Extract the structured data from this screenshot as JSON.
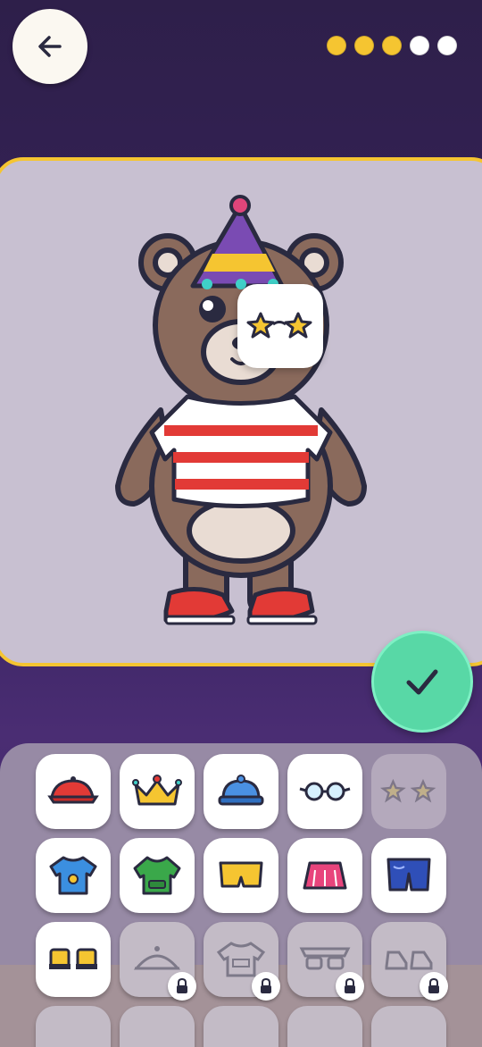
{
  "progress": {
    "completed": 3,
    "total": 5,
    "filled_color": "#f5c531",
    "empty_color": "#ffffff"
  },
  "colors": {
    "stage_border": "#f5c531",
    "confirm": "#58d8a6",
    "bear": "#8a6a5c",
    "outline": "#2a2a40"
  },
  "wardrobe": {
    "items": [
      {
        "icon": "beret-icon",
        "state": "available"
      },
      {
        "icon": "crown-icon",
        "state": "available"
      },
      {
        "icon": "beanie-icon",
        "state": "available"
      },
      {
        "icon": "round-glasses-icon",
        "state": "available"
      },
      {
        "icon": "star-glasses-icon",
        "state": "selected"
      },
      {
        "icon": "blue-tshirt-icon",
        "state": "available"
      },
      {
        "icon": "green-hoodie-icon",
        "state": "available"
      },
      {
        "icon": "yellow-shorts-icon",
        "state": "available"
      },
      {
        "icon": "pink-skirt-icon",
        "state": "available"
      },
      {
        "icon": "blue-jeans-icon",
        "state": "available"
      },
      {
        "icon": "yellow-shoes-icon",
        "state": "available"
      },
      {
        "icon": "party-hat-icon",
        "state": "locked"
      },
      {
        "icon": "tshirt-icon",
        "state": "locked"
      },
      {
        "icon": "sunglasses-icon",
        "state": "locked"
      },
      {
        "icon": "sneakers-icon",
        "state": "locked"
      }
    ]
  }
}
